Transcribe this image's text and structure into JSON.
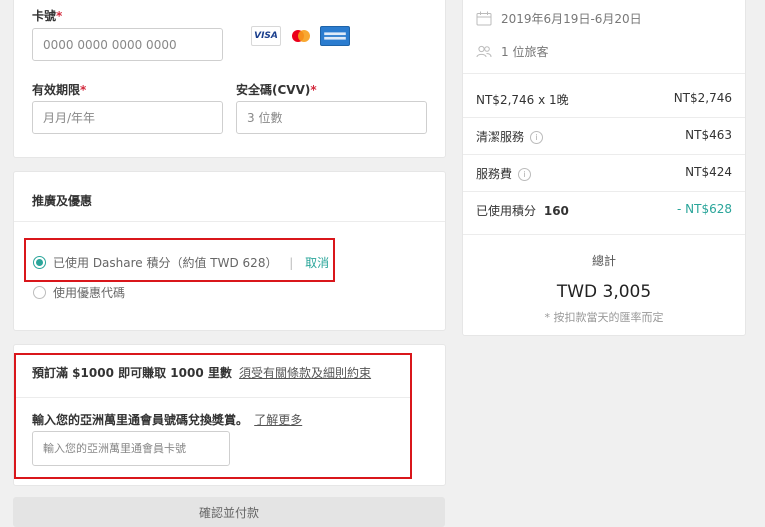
{
  "payment": {
    "card_number_label": "卡號",
    "card_number_placeholder": "0000 0000 0000 0000",
    "card_brands": [
      "visa-logo",
      "mastercard-logo",
      "amex-logo"
    ],
    "visa_text": "VISA",
    "expiry_label": "有效期限",
    "expiry_placeholder": "月月/年年",
    "cvv_label": "安全碼(CVV)",
    "cvv_placeholder": "3 位數",
    "required_mark": "*"
  },
  "promotions": {
    "title": "推廣及優惠",
    "option_points_label": "已使用 Dashare 積分（約值 TWD 628）",
    "option_points_selected": true,
    "separator": "|",
    "cancel_label": "取消",
    "option_coupon_label": "使用優惠代碼"
  },
  "miles": {
    "headline": "預訂滿 $1000 即可賺取 1000 里數",
    "terms_link": "須受有關條款及細則約束",
    "member_label": "輸入您的亞洲萬里通會員號碼兌換獎賞。",
    "learn_more_link": "了解更多",
    "member_placeholder": "輸入您的亞洲萬里通會員卡號"
  },
  "confirm_button": "確認並付款",
  "summary": {
    "dates": "2019年6月19日-6月20日",
    "guests": "1 位旅客",
    "rows": [
      {
        "label": "NT$2,746 x 1晚",
        "value": "NT$2,746"
      },
      {
        "label": "清潔服務",
        "value": "NT$463"
      },
      {
        "label": "服務費",
        "value": "NT$424"
      },
      {
        "label": "已使用積分",
        "points": "160",
        "value": "- NT$628"
      }
    ],
    "total_label": "總計",
    "total_value": "TWD 3,005",
    "total_note": "* 按扣款當天的匯率而定"
  },
  "colors": {
    "accent_teal": "#2aa59a",
    "required_red": "#d32a3d",
    "highlight_red": "#d9161b"
  }
}
